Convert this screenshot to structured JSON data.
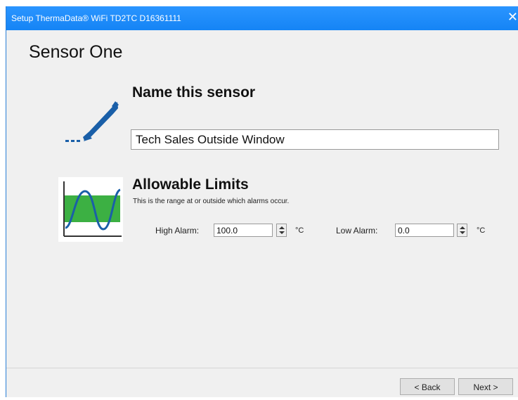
{
  "window": {
    "title": "Setup ThermaData® WiFi TD2TC D16361111",
    "close_glyph": "✕"
  },
  "page": {
    "heading": "Sensor One"
  },
  "name_section": {
    "title": "Name this sensor",
    "icon": "pencil-icon",
    "sensor_name_value": "Tech Sales Outside Window"
  },
  "limits_section": {
    "title": "Allowable Limits",
    "subtitle": "This is the range at or outside which alarms occur.",
    "icon": "chart-limits-icon",
    "high_alarm": {
      "label": "High Alarm:",
      "value": "100.0",
      "unit": "°C"
    },
    "low_alarm": {
      "label": "Low Alarm:",
      "value": "0.0",
      "unit": "°C"
    }
  },
  "footer": {
    "back_label": "< Back",
    "next_label": "Next >"
  },
  "colors": {
    "titlebar": "#1e90ff",
    "accent_blue": "#1a5fa8",
    "limit_band_green": "#3cb043"
  }
}
